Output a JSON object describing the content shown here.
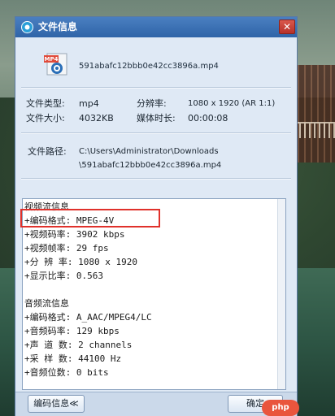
{
  "window": {
    "title": "文件信息",
    "close_symbol": "✕"
  },
  "file": {
    "name": "591abafc12bbb0e42cc3896a.mp4",
    "icon_label": "MP4"
  },
  "properties": {
    "type_label": "文件类型:",
    "type_value": "mp4",
    "resolution_label": "分辨率:",
    "resolution_value": "1080 x 1920 (AR 1:1)",
    "size_label": "文件大小:",
    "size_value": "4032KB",
    "duration_label": "媒体时长:",
    "duration_value": "00:00:08",
    "path_label": "文件路径:",
    "path_line1": "C:\\Users\\Administrator\\Downloads",
    "path_line2": "\\591abafc12bbb0e42cc3896a.mp4"
  },
  "stream_info": {
    "lines": [
      "视频流信息",
      "+编码格式: MPEG-4V",
      "+视频码率: 3902 kbps",
      "+视频帧率: 29 fps",
      "+分 辨 率: 1080 x 1920",
      "+显示比率: 0.563",
      "",
      "音频流信息",
      "+编码格式: A_AAC/MPEG4/LC",
      "+音频码率: 129 kbps",
      "+声 道 数: 2 channels",
      "+采 样 数: 44100 Hz",
      "+音频位数: 0 bits"
    ]
  },
  "buttons": {
    "codec_info": "编码信息≪",
    "ok": "确定"
  },
  "badge": {
    "text": "php"
  },
  "colors": {
    "title_bar": "#2f64a8",
    "highlight": "#e0312b",
    "dialog_bg": "#dfe9f5"
  }
}
